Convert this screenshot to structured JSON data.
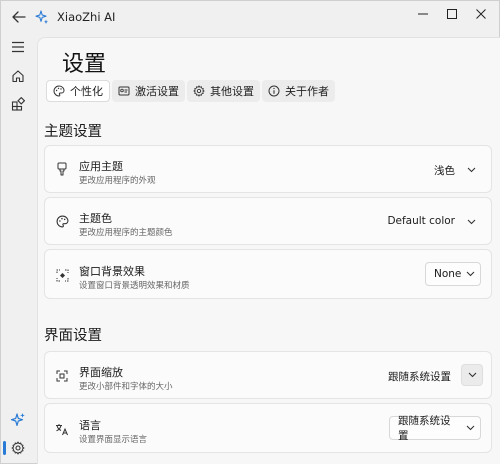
{
  "window": {
    "app_title": "XiaoZhi AI",
    "icons": {
      "back": "back-arrow-icon",
      "app": "sparkle-icon",
      "minimize": "minimize-icon",
      "maximize": "maximize-icon",
      "close": "close-icon"
    }
  },
  "rail": {
    "items": [
      {
        "icon": "hamburger-menu-icon"
      },
      {
        "icon": "home-icon"
      },
      {
        "icon": "apps-icon"
      },
      {
        "icon": "sparkle-icon"
      },
      {
        "icon": "gear-icon"
      }
    ],
    "accent": "#2a7bd6"
  },
  "page": {
    "title": "设置",
    "tabs": [
      {
        "label": "个性化",
        "icon": "palette-icon",
        "active": true
      },
      {
        "label": "激活设置",
        "icon": "activation-icon",
        "active": false
      },
      {
        "label": "其他设置",
        "icon": "gear-icon",
        "active": false
      },
      {
        "label": "关于作者",
        "icon": "info-icon",
        "active": false
      }
    ]
  },
  "theme_section": {
    "title": "主题设置",
    "items": [
      {
        "title": "应用主题",
        "desc": "更改应用程序的外观",
        "value": "浅色",
        "icon": "brush-icon"
      },
      {
        "title": "主题色",
        "desc": "更改应用程序的主题颜色",
        "value": "Default color",
        "icon": "palette-icon"
      },
      {
        "title": "窗口背景效果",
        "desc": "设置窗口背景透明效果和材质",
        "value": "None",
        "icon": "transparency-icon"
      }
    ]
  },
  "ui_section": {
    "title": "界面设置",
    "items": [
      {
        "title": "界面缩放",
        "desc": "更改小部件和字体的大小",
        "value": "跟随系统设置",
        "icon": "scale-icon"
      },
      {
        "title": "语言",
        "desc": "设置界面显示语言",
        "value": "跟随系统设置",
        "icon": "language-icon"
      }
    ]
  }
}
